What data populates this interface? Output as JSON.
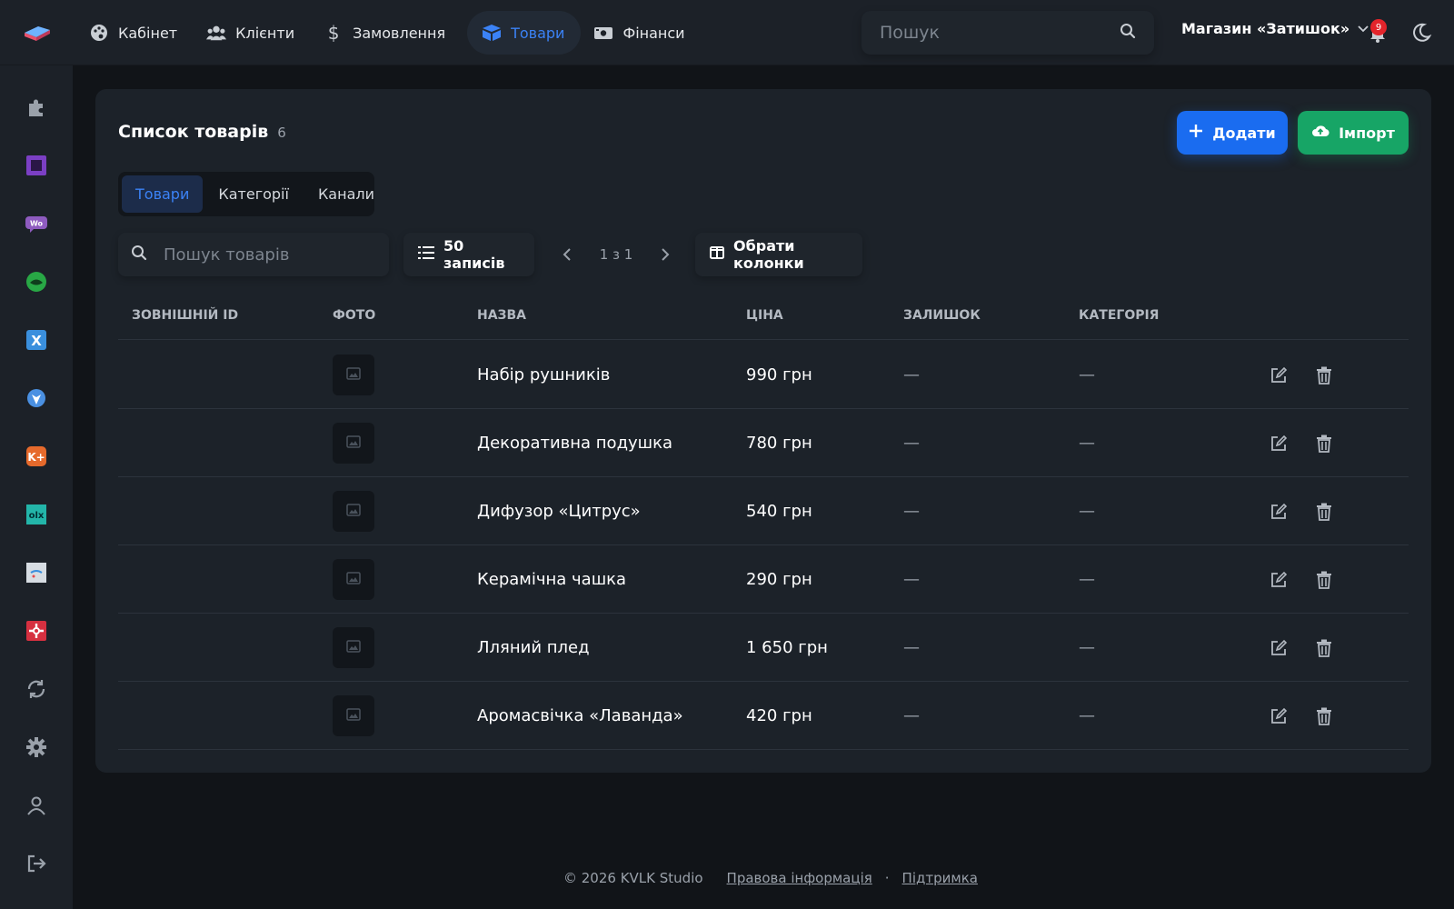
{
  "topbar": {
    "nav": [
      {
        "label": "Кабінет",
        "icon": "palette-icon"
      },
      {
        "label": "Клієнти",
        "icon": "users-icon"
      },
      {
        "label": "Замовлення",
        "icon": "dollar-icon"
      },
      {
        "label": "Товари",
        "icon": "box-icon",
        "active": true
      },
      {
        "label": "Фінанси",
        "icon": "money-icon"
      }
    ],
    "search_placeholder": "Пошук",
    "store_name": "Магазин «Затишок»",
    "notifications_count": "9"
  },
  "sidebar": {
    "items": [
      "puzzle-icon",
      "square-app-icon",
      "woo-icon",
      "green-app-icon",
      "x-app-icon",
      "shield-app-icon",
      "k-plus-app-icon",
      "olx-icon",
      "store-app-icon",
      "red-app-icon",
      "sync-icon",
      "gear-icon",
      "user-icon",
      "logout-icon"
    ]
  },
  "page": {
    "title": "Список товарів",
    "count": "6",
    "add_label": "Додати",
    "import_label": "Імпорт",
    "tabs": [
      "Товари",
      "Категорії",
      "Канали"
    ],
    "search_placeholder": "Пошук товарів",
    "records_label": "50 записів",
    "page_label": "1 з 1",
    "columns_label": "Обрати колонки"
  },
  "table": {
    "headers": [
      "ЗОВНІШНІЙ ID",
      "ФОТО",
      "НАЗВА",
      "ЦІНА",
      "ЗАЛИШОК",
      "КАТЕГОРІЯ"
    ],
    "rows": [
      {
        "name": "Набір рушників",
        "price": "990 грн",
        "stock": "—",
        "category": "—"
      },
      {
        "name": "Декоративна подушка",
        "price": "780 грн",
        "stock": "—",
        "category": "—"
      },
      {
        "name": "Дифузор «Цитрус»",
        "price": "540 грн",
        "stock": "—",
        "category": "—"
      },
      {
        "name": "Керамічна чашка",
        "price": "290 грн",
        "stock": "—",
        "category": "—"
      },
      {
        "name": "Лляний плед",
        "price": "1 650 грн",
        "stock": "—",
        "category": "—"
      },
      {
        "name": "Аромасвічка «Лаванда»",
        "price": "420 грн",
        "stock": "—",
        "category": "—"
      }
    ]
  },
  "footer": {
    "copyright": "© 2026 KVLK Studio",
    "legal": "Правова інформація",
    "separator": "·",
    "support": "Підтримка"
  },
  "colors": {
    "accent": "#1a6cf0",
    "success": "#17a566",
    "background": "#111418",
    "panel": "#1c2229"
  }
}
